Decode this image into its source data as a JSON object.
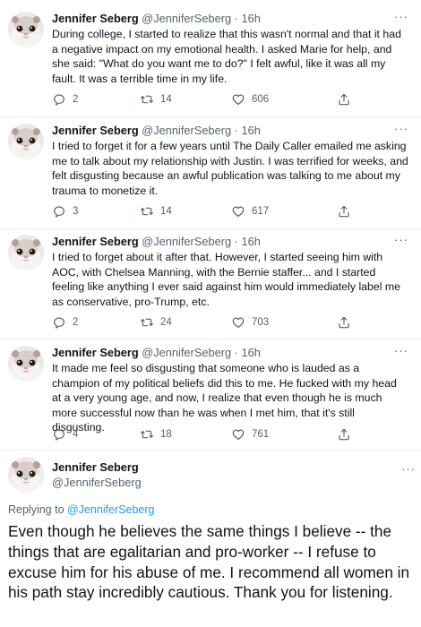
{
  "tweets": [
    {
      "name": "Jennifer Seberg",
      "handle": "@JenniferSeberg",
      "separator": "·",
      "time": "16h",
      "more": "···",
      "text": "During college, I started to realize that this wasn't normal and that it had a negative impact on my emotional health. I asked Marie for help, and she said: \"What do you want me to do?\" I felt awful, like it was all my fault. It was a terrible time in my life.",
      "replies": "2",
      "retweets": "14",
      "likes": "606"
    },
    {
      "name": "Jennifer Seberg",
      "handle": "@JenniferSeberg",
      "separator": "·",
      "time": "16h",
      "more": "···",
      "text": "I tried to forget it for a few years until The Daily Caller emailed me asking me to talk about my relationship with Justin. I was terrified for weeks, and felt disgusting because an awful publication was talking to me about my trauma to monetize it.",
      "replies": "3",
      "retweets": "14",
      "likes": "617"
    },
    {
      "name": "Jennifer Seberg",
      "handle": "@JenniferSeberg",
      "separator": "·",
      "time": "16h",
      "more": "···",
      "text": "I tried to forget about it after that. However, I started seeing him with AOC, with Chelsea Manning, with the Bernie staffer... and I started feeling like anything I ever said against him would immediately label me as conservative, pro-Trump, etc.",
      "replies": "2",
      "retweets": "24",
      "likes": "703"
    },
    {
      "name": "Jennifer Seberg",
      "handle": "@JenniferSeberg",
      "separator": "·",
      "time": "16h",
      "more": "···",
      "text": "It made me feel so disgusting that someone who is lauded as a champion of my political beliefs did this to me. He fucked with my head at a very young age, and now, I realize that even though he is much more successful now than he was when I met him, that it's still disgusting.",
      "replies": "4",
      "retweets": "18",
      "likes": "761"
    }
  ],
  "final_tweet": {
    "name": "Jennifer Seberg",
    "handle": "@JenniferSeberg",
    "more": "···",
    "replying_prefix": "Replying to",
    "replying_to": "@JenniferSeberg",
    "text": "Even though he believes the same things I believe -- the things that are egalitarian and pro-worker -- I refuse to excuse him for his abuse of me. I recommend all women in his path stay incredibly cautious. Thank you for listening."
  },
  "icons": {
    "reply": "reply-icon",
    "retweet": "retweet-icon",
    "like": "like-icon",
    "share": "share-icon",
    "avatar": "hamster-avatar"
  },
  "colors": {
    "text": "#0f1419",
    "secondary": "#536471",
    "link": "#1d9bf0",
    "thread_line": "#cfd9de",
    "divider": "#e6ecf0"
  }
}
